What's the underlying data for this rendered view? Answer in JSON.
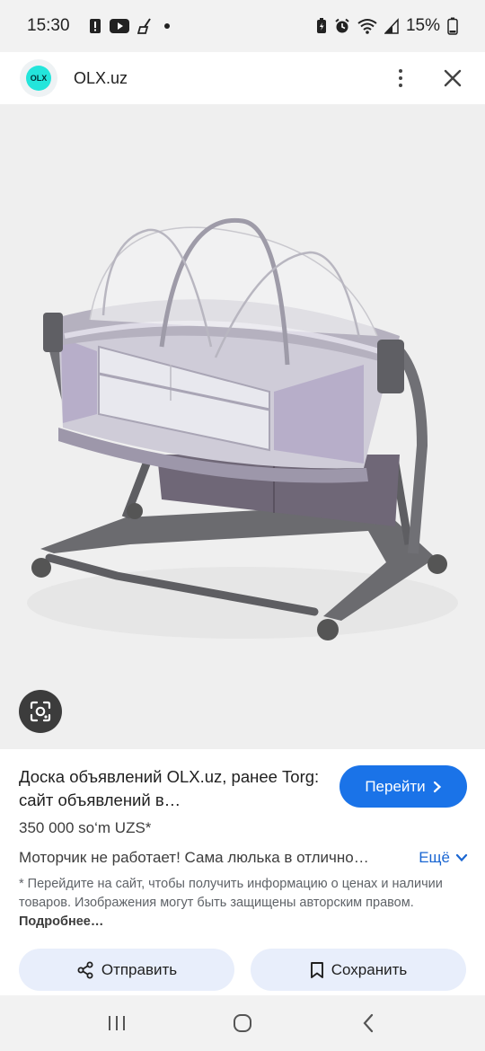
{
  "status_bar": {
    "time": "15:30",
    "battery": "15%",
    "left_icons": [
      "alert-icon",
      "youtube-icon",
      "cleaning-icon",
      "dot-icon"
    ],
    "right_icons": [
      "battery-saver-icon",
      "alarm-icon",
      "wifi-icon",
      "signal-icon"
    ]
  },
  "header": {
    "site_name": "OLX.uz",
    "logo_text": "OLX"
  },
  "result": {
    "title": "Доска объявлений OLX.uz, ранее Torg: сайт объявлений в…",
    "go_label": "Перейти",
    "price": "350 000 so‘m UZS*",
    "description": "Моторчик не работает! Сама люлька в отлично…",
    "more_label": "Ещё",
    "disclaimer": "* Перейдите на сайт, чтобы получить информацию о ценах и наличии товаров. Изображения могут быть защищены авторским правом.",
    "disclaimer_link": "Подробнее…"
  },
  "actions": {
    "share_label": "Отправить",
    "save_label": "Сохранить"
  },
  "colors": {
    "accent": "#1a73e8",
    "action_bg": "#e8eefb",
    "link": "#1a66d2"
  }
}
